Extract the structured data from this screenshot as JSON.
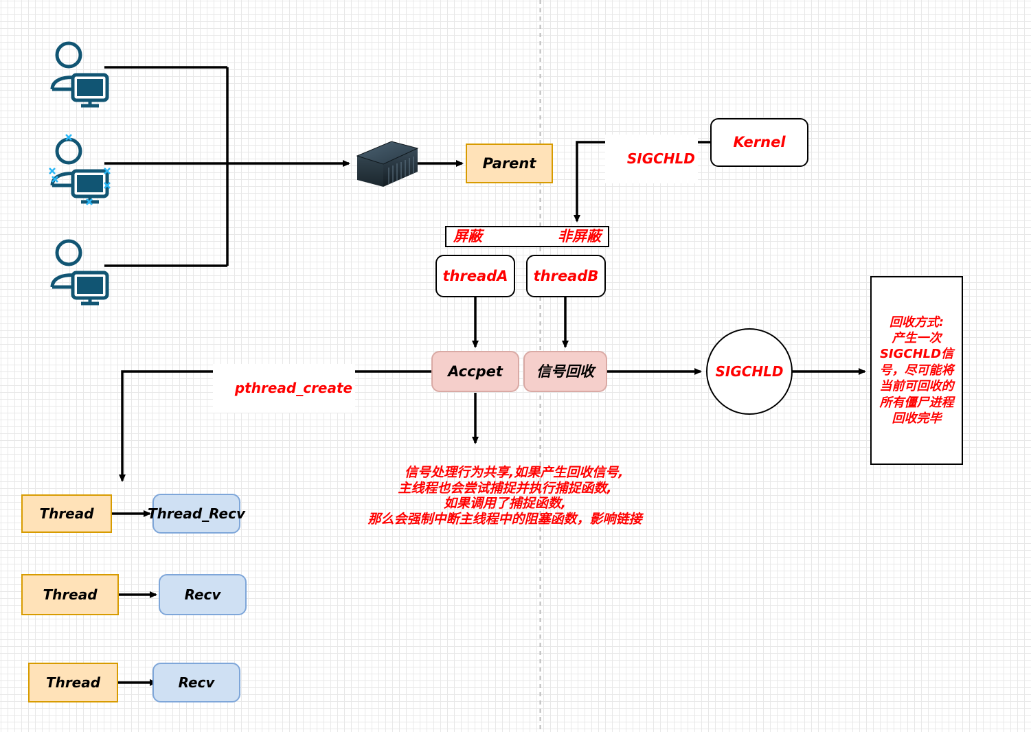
{
  "diagram": {
    "title": "Multithreaded server SIGCHLD signal handling flow",
    "colors": {
      "red": "#ff0000",
      "orange_fill": "#ffe2b8",
      "orange_stroke": "#d79b00",
      "blue_fill": "#cfe0f3",
      "blue_stroke": "#7ea6d9",
      "pink_fill": "#f5cfcb",
      "pink_stroke": "#d9a9a4",
      "icon_teal": "#115573",
      "selection_cyan": "#29b6f6",
      "grid_minor": "#e8e8e8",
      "grid_major": "#d4d4d4"
    }
  },
  "icons": {
    "user_computer_1": "user-with-computer-icon",
    "user_computer_2": "user-with-computer-icon",
    "user_computer_3": "user-with-computer-icon",
    "server_rack": "server-rack-icon"
  },
  "nodes": {
    "parent": {
      "label": "Parent"
    },
    "kernel": {
      "label": "Kernel"
    },
    "mask_bar": {
      "left_label": "屏蔽",
      "right_label": "非屏蔽"
    },
    "thread_a": {
      "label": "threadA"
    },
    "thread_b": {
      "label": "threadB"
    },
    "accept": {
      "label": "Accpet"
    },
    "signal_recycle": {
      "label": "信号回收"
    },
    "sigchld_circle": {
      "label": "SIGCHLD"
    },
    "recycle_note": {
      "label": "回收方式:\n产生一次\nSIGCHLD信\n号，尽可能将\n当前可回收的\n所有僵尸进程\n回收完毕"
    },
    "threads": [
      {
        "label": "Thread"
      },
      {
        "label": "Thread"
      },
      {
        "label": "Thread"
      }
    ],
    "receivers": [
      {
        "label": "Thread_Recv"
      },
      {
        "label": "Recv"
      },
      {
        "label": "Recv"
      }
    ]
  },
  "edge_labels": {
    "sigchld": "SIGCHLD",
    "pthread_create": "pthread_create"
  },
  "annotations": {
    "shared_handler_note": "信号处理行为共享,如果产生回收信号,\n主线程也会尝试捕捉并执行捕捉函数,\n如果调用了捕捉函数,\n那么会强制中断主线程中的阻塞函数，影响链接"
  }
}
